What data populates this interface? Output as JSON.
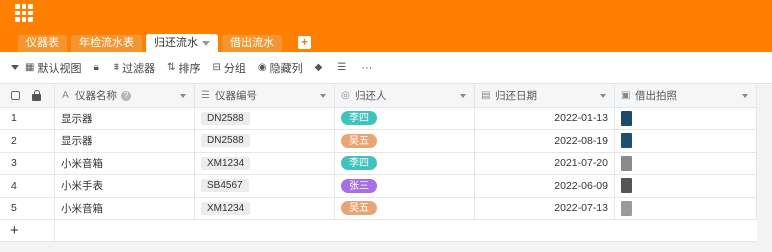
{
  "toolbar_tabs": [
    {
      "label": "仪器表",
      "active": false
    },
    {
      "label": "年检流水表",
      "active": false
    },
    {
      "label": "归还流水",
      "active": true
    },
    {
      "label": "借出流水",
      "active": false
    }
  ],
  "add_tab_label": "+",
  "toolbar": {
    "view_label": "默认视图",
    "filter_label": "过滤器",
    "sort_label": "排序",
    "group_label": "分组",
    "hide_label": "隐藏列",
    "more_label": "···"
  },
  "columns": [
    {
      "label": "仪器名称",
      "icon": "text-icon"
    },
    {
      "label": "仪器编号",
      "icon": "list-icon"
    },
    {
      "label": "归还人",
      "icon": "person-icon"
    },
    {
      "label": "归还日期",
      "icon": "calendar-icon"
    },
    {
      "label": "借出拍照",
      "icon": "image-icon"
    }
  ],
  "rows": [
    {
      "num": "1",
      "name": "显示器",
      "code": "DN2588",
      "person": "李四",
      "person_color": "#3ec4bb",
      "date": "2022-01-13",
      "photo_color": "#1d4a6a"
    },
    {
      "num": "2",
      "name": "显示器",
      "code": "DN2588",
      "person": "吴五",
      "person_color": "#e8a475",
      "date": "2022-08-19",
      "photo_color": "#1e4f6e"
    },
    {
      "num": "3",
      "name": "小米音箱",
      "code": "XM1234",
      "person": "李四",
      "person_color": "#3ec4bb",
      "date": "2021-07-20",
      "photo_color": "#8a8a8a"
    },
    {
      "num": "4",
      "name": "小米手表",
      "code": "SB4567",
      "person": "张三",
      "person_color": "#a86ee6",
      "date": "2022-06-09",
      "photo_color": "#555555"
    },
    {
      "num": "5",
      "name": "小米音箱",
      "code": "XM1234",
      "person": "吴五",
      "person_color": "#e8a475",
      "date": "2022-07-13",
      "photo_color": "#9a9a9a"
    }
  ],
  "add_row_label": "+",
  "colors": {
    "topbar": "#ff8000",
    "tab_inactive": "#f39632"
  }
}
